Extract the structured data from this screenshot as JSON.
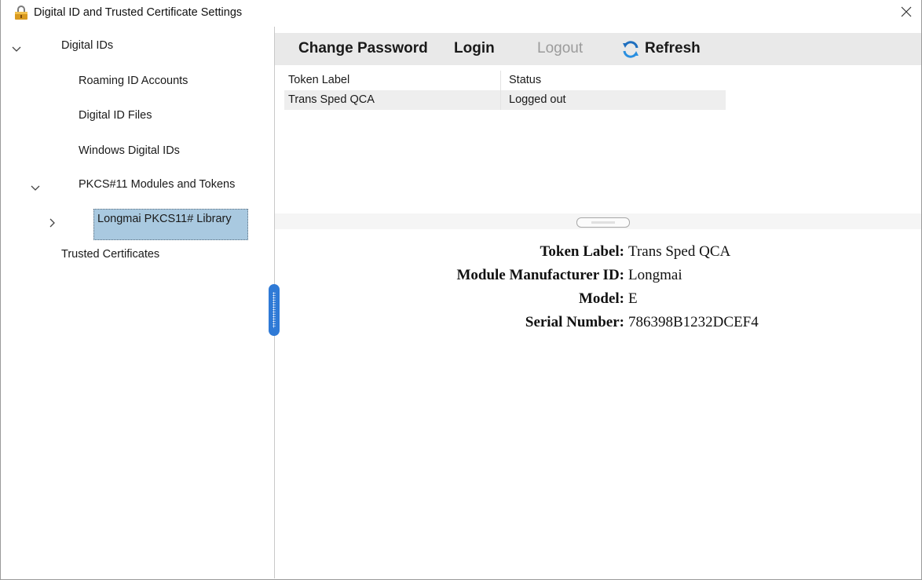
{
  "window": {
    "title": "Digital ID and Trusted Certificate Settings"
  },
  "sidebar": {
    "digital_ids": "Digital IDs",
    "roaming_id_accounts": "Roaming ID Accounts",
    "digital_id_files": "Digital ID Files",
    "windows_digital_ids": "Windows Digital IDs",
    "pkcs11_modules": "PKCS#11 Modules and Tokens",
    "selected_library": "Longmai PKCS11# Library",
    "trusted_certificates": "Trusted Certificates"
  },
  "toolbar": {
    "change_password": "Change Password",
    "login": "Login",
    "logout": "Logout",
    "refresh": "Refresh"
  },
  "token_table": {
    "headers": [
      "Token Label",
      "Status"
    ],
    "rows": [
      [
        "Trans Sped QCA",
        "Logged out"
      ]
    ]
  },
  "details": {
    "token_label": {
      "label": "Token Label:",
      "value": "Trans Sped QCA"
    },
    "manufacturer_id": {
      "label": "Module Manufacturer ID:",
      "value": "Longmai"
    },
    "model": {
      "label": "Model:",
      "value": "E"
    },
    "serial_number": {
      "label": "Serial Number:",
      "value": "786398B1232DCEF4"
    }
  },
  "colors": {
    "selection": "#a9c9e0",
    "splitter_accent": "#2f7ad6",
    "toolbar_bg": "#e9e9e9",
    "disabled_text": "#9b9b9b"
  }
}
